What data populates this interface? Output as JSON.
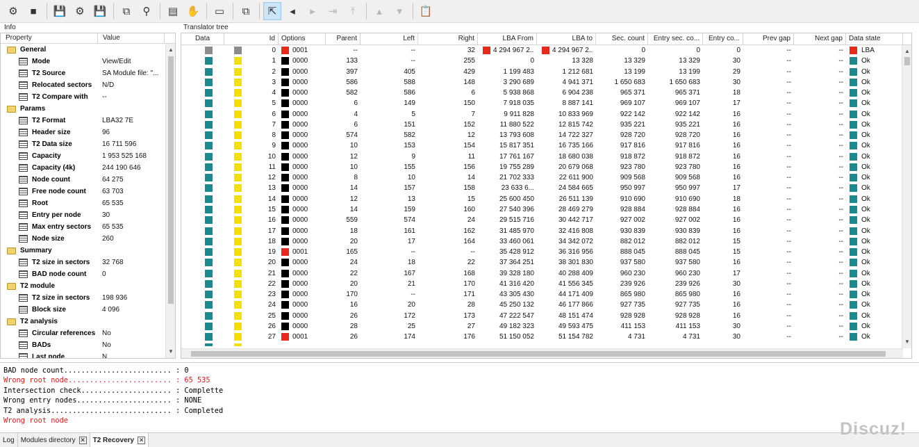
{
  "toolbar": {
    "buttons": [
      {
        "name": "open-settings-icon",
        "glyph": "⚙"
      },
      {
        "name": "stop-icon",
        "glyph": "■"
      },
      {
        "sep": true
      },
      {
        "name": "save-icon",
        "glyph": "💾"
      },
      {
        "name": "save-settings-icon",
        "glyph": "⚙"
      },
      {
        "name": "save-all-icon",
        "glyph": "💾"
      },
      {
        "sep": true
      },
      {
        "name": "copy-page-icon",
        "glyph": "⧉"
      },
      {
        "name": "user-search-icon",
        "glyph": "⚲"
      },
      {
        "sep": true
      },
      {
        "name": "binary-table-icon",
        "glyph": "▤"
      },
      {
        "name": "hand-icon",
        "glyph": "✋"
      },
      {
        "sep": true
      },
      {
        "name": "document-icon",
        "glyph": "▭"
      },
      {
        "sep": true
      },
      {
        "name": "copy-icon",
        "glyph": "⧉"
      },
      {
        "sep": true
      },
      {
        "name": "export-icon",
        "glyph": "⇱",
        "active": true
      },
      {
        "name": "prev-icon",
        "glyph": "◂"
      },
      {
        "name": "next-icon",
        "glyph": "▸"
      },
      {
        "name": "jump-end-icon",
        "glyph": "⇥"
      },
      {
        "name": "jump-top-icon",
        "glyph": "⤒"
      },
      {
        "sep": true
      },
      {
        "name": "up-icon",
        "glyph": "▴"
      },
      {
        "name": "down-icon",
        "glyph": "▾"
      },
      {
        "sep": true
      },
      {
        "name": "clipboard-icon",
        "glyph": "📋"
      }
    ]
  },
  "info": {
    "title": "Info",
    "col_property": "Property",
    "col_value": "Value",
    "rows": [
      {
        "type": "group",
        "label": "General"
      },
      {
        "type": "item",
        "label": "Mode",
        "value": "View/Edit"
      },
      {
        "type": "item",
        "label": "T2 Source",
        "value": "SA Module file: \"..."
      },
      {
        "type": "item",
        "label": "Relocated sectors",
        "value": "N/D"
      },
      {
        "type": "item",
        "label": "T2 Compare with",
        "value": "--"
      },
      {
        "type": "group",
        "label": "Params"
      },
      {
        "type": "item",
        "label": "T2 Format",
        "value": "LBA32 7E"
      },
      {
        "type": "item",
        "label": "Header size",
        "value": "96"
      },
      {
        "type": "item",
        "label": "T2 Data size",
        "value": "16 711 596"
      },
      {
        "type": "item",
        "label": "Capacity",
        "value": "1 953 525 168"
      },
      {
        "type": "item",
        "label": "Capacity (4k)",
        "value": "244 190 646"
      },
      {
        "type": "item",
        "label": "Node count",
        "value": "64 275"
      },
      {
        "type": "item",
        "label": "Free node count",
        "value": "63 703"
      },
      {
        "type": "item",
        "label": "Root",
        "value": "65 535"
      },
      {
        "type": "item",
        "label": "Entry per node",
        "value": "30"
      },
      {
        "type": "item",
        "label": "Max entry sectors",
        "value": "65 535"
      },
      {
        "type": "item",
        "label": "Node size",
        "value": "260"
      },
      {
        "type": "group",
        "label": "Summary"
      },
      {
        "type": "item",
        "label": "T2 size in sectors",
        "value": "32 768"
      },
      {
        "type": "item",
        "label": "BAD node count",
        "value": "0"
      },
      {
        "type": "group",
        "label": "T2 module"
      },
      {
        "type": "item",
        "label": "T2 size in sectors",
        "value": "198 936"
      },
      {
        "type": "item",
        "label": "Block size",
        "value": "4 096"
      },
      {
        "type": "group",
        "label": "T2 analysis"
      },
      {
        "type": "item",
        "label": "Circular references",
        "value": "No"
      },
      {
        "type": "item",
        "label": "BADs",
        "value": "No"
      },
      {
        "type": "item",
        "label": "Last node",
        "value": "N"
      }
    ]
  },
  "tree": {
    "title": "Translator tree",
    "columns": [
      "Data",
      "Id",
      "Options",
      "Parent",
      "Left",
      "Right",
      "LBA From",
      "LBA to",
      "Sec. count",
      "Entry sec. co...",
      "Entry co...",
      "Prev gap",
      "Next gap",
      "Data state"
    ],
    "rows": [
      {
        "data": "#8c8c8c",
        "id": "0",
        "opt_color": "#e8291c",
        "opt": "0001",
        "parent": "--",
        "left": "--",
        "right": "32",
        "from_flag": "#e8291c",
        "from": "4 294 967 2...",
        "to_flag": "#e8291c",
        "to": "4 294 967 2...",
        "sec": "0",
        "esec": "0",
        "ecnt": "0",
        "prev": "--",
        "next": "--",
        "state_color": "#e8291c",
        "state": "LBA"
      },
      {
        "data": "#1a8a8f",
        "color2": "#f2e000",
        "id": "1",
        "opt_color": "#000000",
        "opt": "0000",
        "parent": "133",
        "left": "--",
        "right": "255",
        "from": "0",
        "to": "13 328",
        "sec": "13 329",
        "esec": "13 329",
        "ecnt": "30",
        "prev": "--",
        "next": "--",
        "state_color": "#1a8a8f",
        "state": "Ok"
      },
      {
        "data": "#1a8a8f",
        "color2": "#f2e000",
        "id": "2",
        "opt_color": "#000000",
        "opt": "0000",
        "parent": "397",
        "left": "405",
        "right": "429",
        "from": "1 199 483",
        "to": "1 212 681",
        "sec": "13 199",
        "esec": "13 199",
        "ecnt": "29",
        "prev": "--",
        "next": "--",
        "state_color": "#1a8a8f",
        "state": "Ok"
      },
      {
        "data": "#1a8a8f",
        "color2": "#f2e000",
        "id": "3",
        "opt_color": "#000000",
        "opt": "0000",
        "parent": "586",
        "left": "588",
        "right": "148",
        "from": "3 290 689",
        "to": "4 941 371",
        "sec": "1 650 683",
        "esec": "1 650 683",
        "ecnt": "30",
        "prev": "--",
        "next": "--",
        "state_color": "#1a8a8f",
        "state": "Ok"
      },
      {
        "data": "#1a8a8f",
        "color2": "#f2e000",
        "id": "4",
        "opt_color": "#000000",
        "opt": "0000",
        "parent": "582",
        "left": "586",
        "right": "6",
        "from": "5 938 868",
        "to": "6 904 238",
        "sec": "965 371",
        "esec": "965 371",
        "ecnt": "18",
        "prev": "--",
        "next": "--",
        "state_color": "#1a8a8f",
        "state": "Ok"
      },
      {
        "data": "#1a8a8f",
        "color2": "#f2e000",
        "id": "5",
        "opt_color": "#000000",
        "opt": "0000",
        "parent": "6",
        "left": "149",
        "right": "150",
        "from": "7 918 035",
        "to": "8 887 141",
        "sec": "969 107",
        "esec": "969 107",
        "ecnt": "17",
        "prev": "--",
        "next": "--",
        "state_color": "#1a8a8f",
        "state": "Ok"
      },
      {
        "data": "#1a8a8f",
        "color2": "#f2e000",
        "id": "6",
        "opt_color": "#000000",
        "opt": "0000",
        "parent": "4",
        "left": "5",
        "right": "7",
        "from": "9 911 828",
        "to": "10 833 969",
        "sec": "922 142",
        "esec": "922 142",
        "ecnt": "16",
        "prev": "--",
        "next": "--",
        "state_color": "#1a8a8f",
        "state": "Ok"
      },
      {
        "data": "#1a8a8f",
        "color2": "#f2e000",
        "id": "7",
        "opt_color": "#000000",
        "opt": "0000",
        "parent": "6",
        "left": "151",
        "right": "152",
        "from": "11 880 522",
        "to": "12 815 742",
        "sec": "935 221",
        "esec": "935 221",
        "ecnt": "16",
        "prev": "--",
        "next": "--",
        "state_color": "#1a8a8f",
        "state": "Ok"
      },
      {
        "data": "#1a8a8f",
        "color2": "#f2e000",
        "id": "8",
        "opt_color": "#000000",
        "opt": "0000",
        "parent": "574",
        "left": "582",
        "right": "12",
        "from": "13 793 608",
        "to": "14 722 327",
        "sec": "928 720",
        "esec": "928 720",
        "ecnt": "16",
        "prev": "--",
        "next": "--",
        "state_color": "#1a8a8f",
        "state": "Ok"
      },
      {
        "data": "#1a8a8f",
        "color2": "#f2e000",
        "id": "9",
        "opt_color": "#000000",
        "opt": "0000",
        "parent": "10",
        "left": "153",
        "right": "154",
        "from": "15 817 351",
        "to": "16 735 166",
        "sec": "917 816",
        "esec": "917 816",
        "ecnt": "16",
        "prev": "--",
        "next": "--",
        "state_color": "#1a8a8f",
        "state": "Ok"
      },
      {
        "data": "#1a8a8f",
        "color2": "#f2e000",
        "id": "10",
        "opt_color": "#000000",
        "opt": "0000",
        "parent": "12",
        "left": "9",
        "right": "11",
        "from": "17 761 167",
        "to": "18 680 038",
        "sec": "918 872",
        "esec": "918 872",
        "ecnt": "16",
        "prev": "--",
        "next": "--",
        "state_color": "#1a8a8f",
        "state": "Ok"
      },
      {
        "data": "#1a8a8f",
        "color2": "#f2e000",
        "id": "11",
        "opt_color": "#000000",
        "opt": "0000",
        "parent": "10",
        "left": "155",
        "right": "156",
        "from": "19 755 289",
        "to": "20 679 068",
        "sec": "923 780",
        "esec": "923 780",
        "ecnt": "16",
        "prev": "--",
        "next": "--",
        "state_color": "#1a8a8f",
        "state": "Ok"
      },
      {
        "data": "#1a8a8f",
        "color2": "#f2e000",
        "id": "12",
        "opt_color": "#000000",
        "opt": "0000",
        "parent": "8",
        "left": "10",
        "right": "14",
        "from": "21 702 333",
        "to": "22 611 900",
        "sec": "909 568",
        "esec": "909 568",
        "ecnt": "16",
        "prev": "--",
        "next": "--",
        "state_color": "#1a8a8f",
        "state": "Ok"
      },
      {
        "data": "#1a8a8f",
        "color2": "#f2e000",
        "id": "13",
        "opt_color": "#000000",
        "opt": "0000",
        "parent": "14",
        "left": "157",
        "right": "158",
        "from": "23 633 6...",
        "to": "24 584 665",
        "sec": "950 997",
        "esec": "950 997",
        "ecnt": "17",
        "prev": "--",
        "next": "--",
        "state_color": "#1a8a8f",
        "state": "Ok"
      },
      {
        "data": "#1a8a8f",
        "color2": "#f2e000",
        "id": "14",
        "opt_color": "#000000",
        "opt": "0000",
        "parent": "12",
        "left": "13",
        "right": "15",
        "from": "25 600 450",
        "to": "26 511 139",
        "sec": "910 690",
        "esec": "910 690",
        "ecnt": "18",
        "prev": "--",
        "next": "--",
        "state_color": "#1a8a8f",
        "state": "Ok"
      },
      {
        "data": "#1a8a8f",
        "color2": "#f2e000",
        "id": "15",
        "opt_color": "#000000",
        "opt": "0000",
        "parent": "14",
        "left": "159",
        "right": "160",
        "from": "27 540 396",
        "to": "28 469 279",
        "sec": "928 884",
        "esec": "928 884",
        "ecnt": "16",
        "prev": "--",
        "next": "--",
        "state_color": "#1a8a8f",
        "state": "Ok"
      },
      {
        "data": "#1a8a8f",
        "color2": "#f2e000",
        "id": "16",
        "opt_color": "#000000",
        "opt": "0000",
        "parent": "559",
        "left": "574",
        "right": "24",
        "from": "29 515 716",
        "to": "30 442 717",
        "sec": "927 002",
        "esec": "927 002",
        "ecnt": "16",
        "prev": "--",
        "next": "--",
        "state_color": "#1a8a8f",
        "state": "Ok"
      },
      {
        "data": "#1a8a8f",
        "color2": "#f2e000",
        "id": "17",
        "opt_color": "#000000",
        "opt": "0000",
        "parent": "18",
        "left": "161",
        "right": "162",
        "from": "31 485 970",
        "to": "32 416 808",
        "sec": "930 839",
        "esec": "930 839",
        "ecnt": "16",
        "prev": "--",
        "next": "--",
        "state_color": "#1a8a8f",
        "state": "Ok"
      },
      {
        "data": "#1a8a8f",
        "color2": "#f2e000",
        "id": "18",
        "opt_color": "#000000",
        "opt": "0000",
        "parent": "20",
        "left": "17",
        "right": "164",
        "from": "33 460 061",
        "to": "34 342 072",
        "sec": "882 012",
        "esec": "882 012",
        "ecnt": "15",
        "prev": "--",
        "next": "--",
        "state_color": "#1a8a8f",
        "state": "Ok"
      },
      {
        "data": "#1a8a8f",
        "color2": "#f2e000",
        "id": "19",
        "opt_color": "#e8291c",
        "opt": "0001",
        "parent": "165",
        "left": "--",
        "right": "--",
        "from": "35 428 912",
        "to": "36 316 956",
        "sec": "888 045",
        "esec": "888 045",
        "ecnt": "15",
        "prev": "--",
        "next": "--",
        "state_color": "#1a8a8f",
        "state": "Ok"
      },
      {
        "data": "#1a8a8f",
        "color2": "#f2e000",
        "id": "20",
        "opt_color": "#000000",
        "opt": "0000",
        "parent": "24",
        "left": "18",
        "right": "22",
        "from": "37 364 251",
        "to": "38 301 830",
        "sec": "937 580",
        "esec": "937 580",
        "ecnt": "16",
        "prev": "--",
        "next": "--",
        "state_color": "#1a8a8f",
        "state": "Ok"
      },
      {
        "data": "#1a8a8f",
        "color2": "#f2e000",
        "id": "21",
        "opt_color": "#000000",
        "opt": "0000",
        "parent": "22",
        "left": "167",
        "right": "168",
        "from": "39 328 180",
        "to": "40 288 409",
        "sec": "960 230",
        "esec": "960 230",
        "ecnt": "17",
        "prev": "--",
        "next": "--",
        "state_color": "#1a8a8f",
        "state": "Ok"
      },
      {
        "data": "#1a8a8f",
        "color2": "#f2e000",
        "id": "22",
        "opt_color": "#000000",
        "opt": "0000",
        "parent": "20",
        "left": "21",
        "right": "170",
        "from": "41 316 420",
        "to": "41 556 345",
        "sec": "239 926",
        "esec": "239 926",
        "ecnt": "30",
        "prev": "--",
        "next": "--",
        "state_color": "#1a8a8f",
        "state": "Ok"
      },
      {
        "data": "#1a8a8f",
        "color2": "#f2e000",
        "id": "23",
        "opt_color": "#000000",
        "opt": "0000",
        "parent": "170",
        "left": "--",
        "right": "171",
        "from": "43 305 430",
        "to": "44 171 409",
        "sec": "865 980",
        "esec": "865 980",
        "ecnt": "16",
        "prev": "--",
        "next": "--",
        "state_color": "#1a8a8f",
        "state": "Ok"
      },
      {
        "data": "#1a8a8f",
        "color2": "#f2e000",
        "id": "24",
        "opt_color": "#000000",
        "opt": "0000",
        "parent": "16",
        "left": "20",
        "right": "28",
        "from": "45 250 132",
        "to": "46 177 866",
        "sec": "927 735",
        "esec": "927 735",
        "ecnt": "16",
        "prev": "--",
        "next": "--",
        "state_color": "#1a8a8f",
        "state": "Ok"
      },
      {
        "data": "#1a8a8f",
        "color2": "#f2e000",
        "id": "25",
        "opt_color": "#000000",
        "opt": "0000",
        "parent": "26",
        "left": "172",
        "right": "173",
        "from": "47 222 547",
        "to": "48 151 474",
        "sec": "928 928",
        "esec": "928 928",
        "ecnt": "16",
        "prev": "--",
        "next": "--",
        "state_color": "#1a8a8f",
        "state": "Ok"
      },
      {
        "data": "#1a8a8f",
        "color2": "#f2e000",
        "id": "26",
        "opt_color": "#000000",
        "opt": "0000",
        "parent": "28",
        "left": "25",
        "right": "27",
        "from": "49 182 323",
        "to": "49 593 475",
        "sec": "411 153",
        "esec": "411 153",
        "ecnt": "30",
        "prev": "--",
        "next": "--",
        "state_color": "#1a8a8f",
        "state": "Ok"
      },
      {
        "data": "#1a8a8f",
        "color2": "#f2e000",
        "id": "27",
        "opt_color": "#e8291c",
        "opt": "0001",
        "parent": "26",
        "left": "174",
        "right": "176",
        "from": "51 150 052",
        "to": "51 154 782",
        "sec": "4 731",
        "esec": "4 731",
        "ecnt": "30",
        "prev": "--",
        "next": "--",
        "state_color": "#1a8a8f",
        "state": "Ok"
      }
    ]
  },
  "log": {
    "lines": [
      {
        "text": "BAD node count......................... : 0",
        "color": "#000000"
      },
      {
        "text": "Wrong root node........................ : 65 535",
        "color": "#d42020"
      },
      {
        "text": "Intersection check..................... : Complette",
        "color": "#000000"
      },
      {
        "text": "Wrong entry nodes...................... : NONE",
        "color": "#000000"
      },
      {
        "text": "T2 analysis............................ : Completed",
        "color": "#000000"
      },
      {
        "text": "Wrong root node",
        "color": "#d42020"
      }
    ]
  },
  "tabs": [
    {
      "label": "Log",
      "active": false,
      "close": false
    },
    {
      "label": "Modules directory",
      "active": false,
      "close": true
    },
    {
      "label": "T2 Recovery",
      "active": true,
      "close": true
    }
  ],
  "watermark": "Discuz!"
}
